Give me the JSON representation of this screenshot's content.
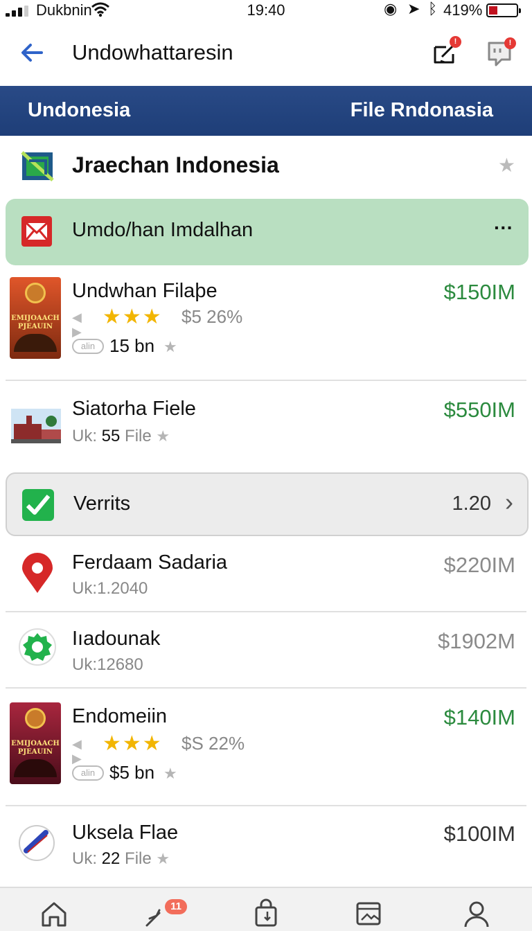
{
  "status_bar": {
    "carrier": "Dukbnin",
    "time": "19:40",
    "battery_pct": "419%"
  },
  "header": {
    "title": "Undowhattaresin"
  },
  "band": {
    "left": "Undonesia",
    "right": "File Rndonasia"
  },
  "section": {
    "title": "Jraechan Indonesia"
  },
  "highlight": {
    "label": "Umdo/han Imdalhan",
    "more": "···"
  },
  "items": [
    {
      "name": "Undwhan Filaþe",
      "price": "$150IM",
      "rating_text": "$5 26%",
      "pill": "alin",
      "meta": "15 bn",
      "thumb_lines": [
        "EMIJOAACH",
        "PJEAUIN"
      ],
      "stars": "★★★"
    },
    {
      "name": "Siatorha Fiele",
      "price": "$550IM",
      "sub_prefix": "Uk: ",
      "sub_value": "55",
      "sub_suffix": " File"
    },
    {
      "name": "Ferdaam Sadaria",
      "price": "$220IM",
      "sub": "Uk:1.2040"
    },
    {
      "name": "Iıadounak",
      "price": "$1902M",
      "sub": "Uk:12680"
    },
    {
      "name": "Endomeiin",
      "price": "$140IM",
      "rating_text": "$S 22%",
      "pill": "alin",
      "meta": "$5 bn",
      "thumb_lines": [
        "EMIJOAACH",
        "PJEAUIN"
      ],
      "stars": "★★★"
    },
    {
      "name": "Uksela Flae",
      "price": "$100IM",
      "sub_prefix": "Uk: ",
      "sub_value": "22",
      "sub_suffix": " File"
    }
  ],
  "verrits": {
    "label": "Verrits",
    "value": "1.20",
    "chevron": "›"
  },
  "tabbar": {
    "badge": "11"
  },
  "colors": {
    "band": "#294a86",
    "highlight": "#b9dfc1",
    "price_green": "#2b8a3e",
    "badge_red": "#e53935"
  },
  "icons": [
    "back-arrow-icon",
    "share-notification-icon",
    "chat-notification-icon",
    "box-check-icon",
    "envelope-icon",
    "check-square-icon",
    "location-pin-icon",
    "gear-icon",
    "home-icon",
    "send-icon",
    "bag-icon",
    "gallery-icon",
    "profile-icon"
  ]
}
